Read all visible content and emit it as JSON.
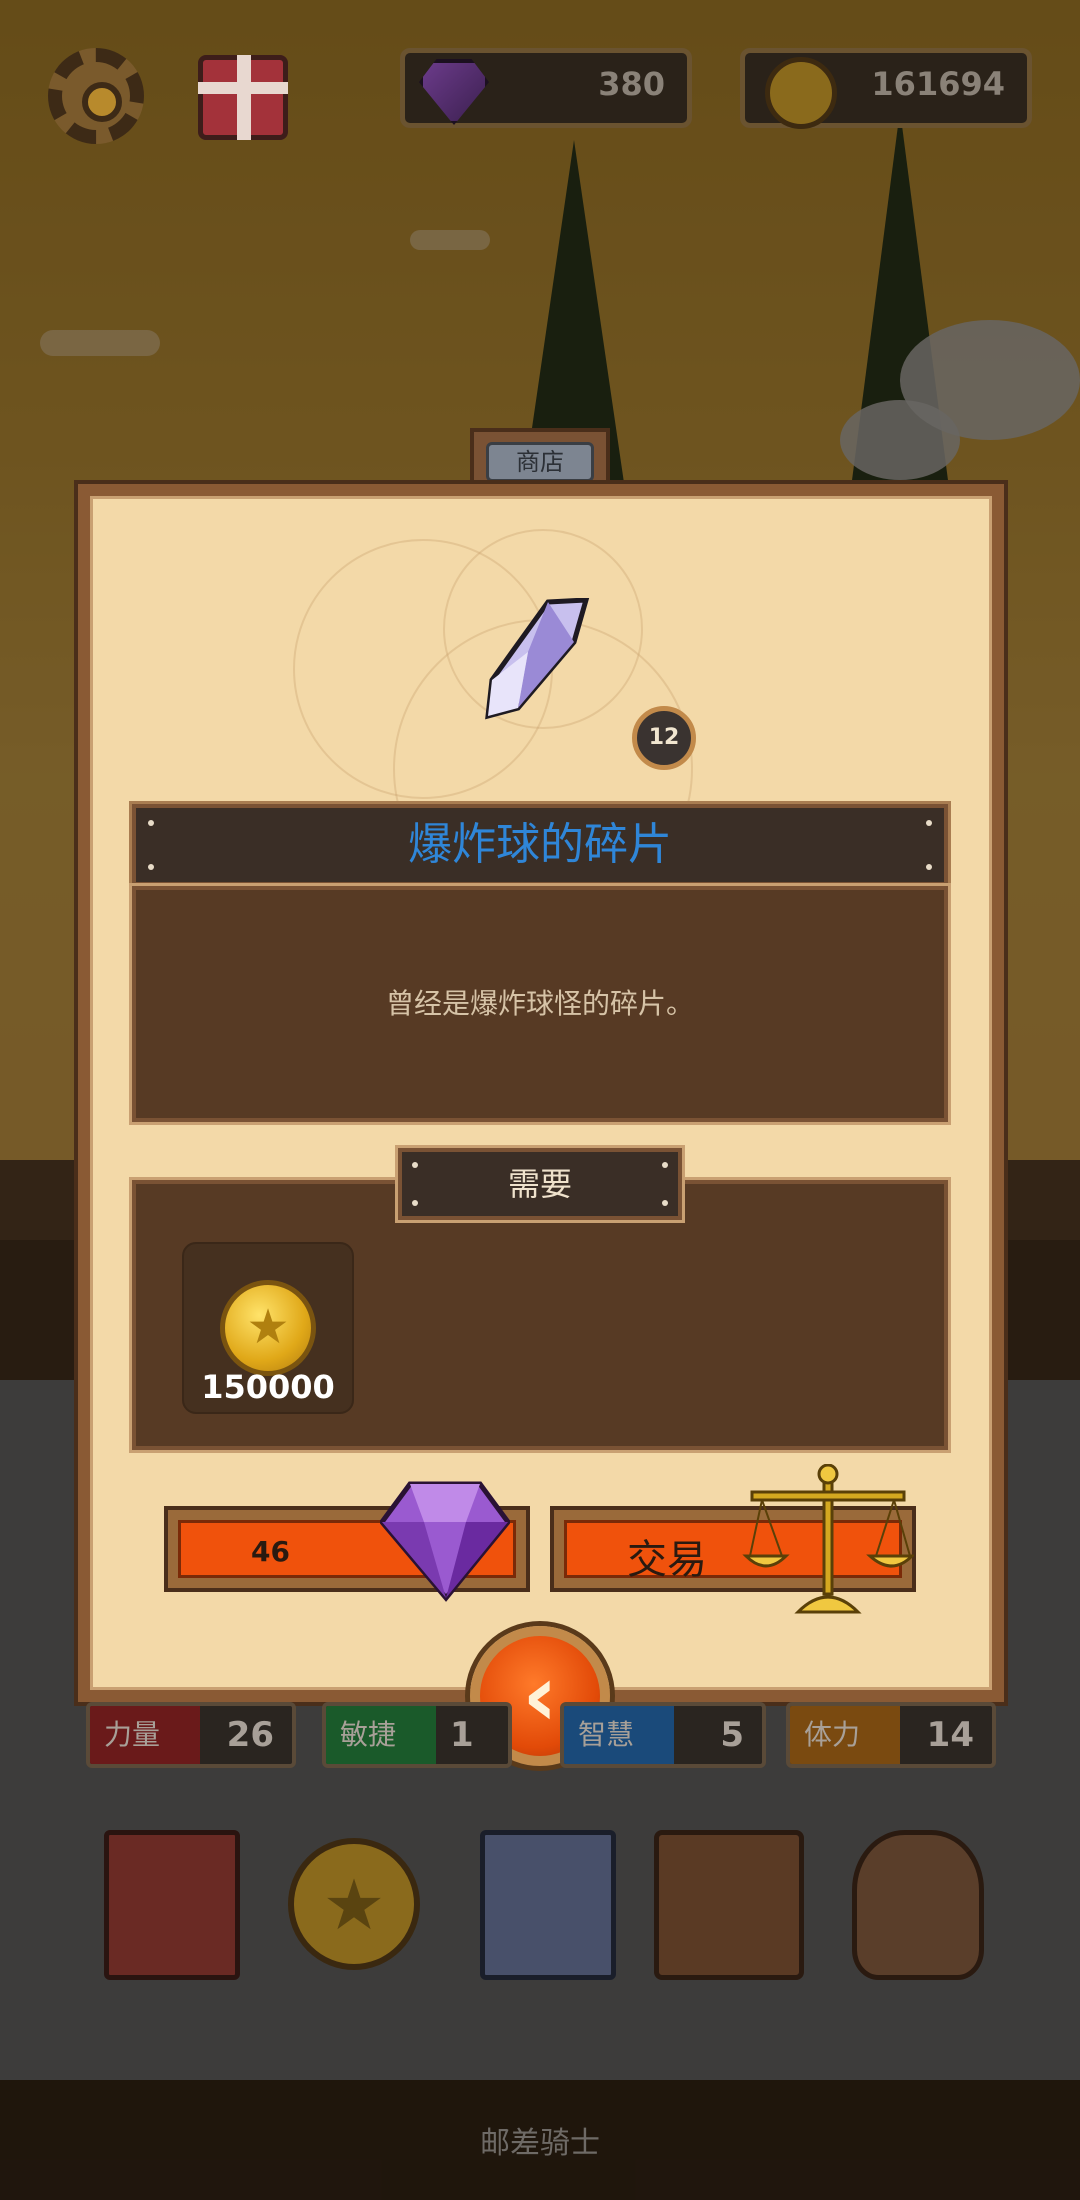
{
  "topbar": {
    "settings_icon": "gear-icon",
    "gift_icon": "gift-icon",
    "gems": "380",
    "gold": "161694"
  },
  "panel": {
    "tab_label": "商店",
    "item_count": "12",
    "item_name": "爆炸球的碎片",
    "item_description": "曾经是爆炸球怪的碎片。",
    "requirements_label": "需要",
    "requirement_amount": "150000",
    "buy_with_gems_value": "46",
    "trade_label": "交易"
  },
  "stats": [
    {
      "label": "力量",
      "value": "26",
      "color": "#6a1a1a"
    },
    {
      "label": "敏捷",
      "value": "1",
      "color": "#1a5a2a"
    },
    {
      "label": "智慧",
      "value": "5",
      "color": "#1a4a7a"
    },
    {
      "label": "体力",
      "value": "14",
      "color": "#7a4a10"
    }
  ],
  "footer": {
    "title": "邮差骑士"
  },
  "colors": {
    "title_blue": "#2f86d8",
    "button_orange": "#f0520c",
    "panel_parchment": "#f3d9a8"
  }
}
